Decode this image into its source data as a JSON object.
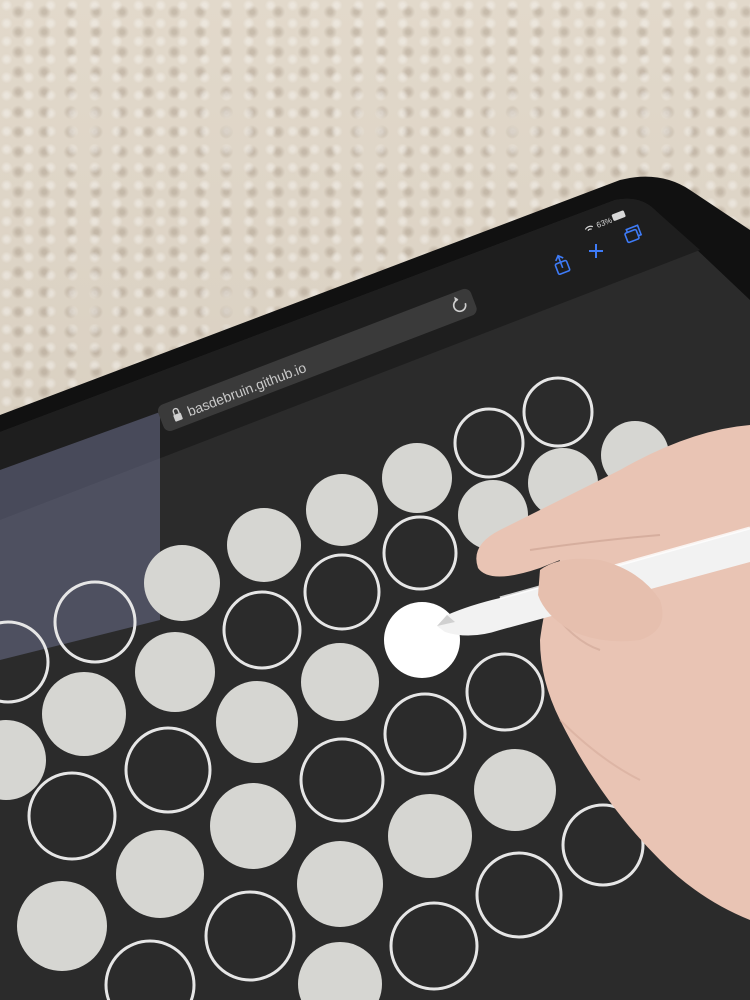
{
  "browser": {
    "url": "basdebruin.github.io",
    "battery": "63%",
    "icons": [
      "wifi-icon",
      "share-icon",
      "plus-icon",
      "tabs-icon",
      "reload-icon",
      "lock-icon"
    ]
  },
  "colors": {
    "screen_bg": "#2b2b2b",
    "filled_dot": "#d6d6d2",
    "outline_dot": "#e6e6e6",
    "active_dot": "#ffffff",
    "ipad_bezel": "#111111"
  }
}
